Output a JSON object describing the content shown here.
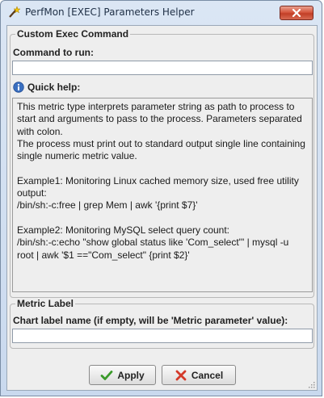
{
  "window": {
    "title": "PerfMon [EXEC] Parameters Helper",
    "close_icon": "close-icon"
  },
  "custom_exec": {
    "group_title": "Custom Exec Command",
    "command_label": "Command to run:",
    "command_value": "",
    "quick_help_label": "Quick help:",
    "help_text": "This metric type interprets parameter string as path to process to start and arguments to pass to the process. Parameters separated with colon.\nThe process must print out to standard output single line containing single numeric metric value.\n\nExample1: Monitoring Linux cached memory size, used free utility output:\n/bin/sh:-c:free | grep Mem | awk '{print $7}'\n\nExample2: Monitoring MySQL select query count:\n/bin/sh:-c:echo \"show global status like 'Com_select'\" | mysql -u root | awk '$1 ==\"Com_select\" {print $2}'"
  },
  "metric_label": {
    "group_title": "Metric Label",
    "chart_label": "Chart label name (if empty, will be 'Metric parameter' value):",
    "chart_value": ""
  },
  "buttons": {
    "apply_label": "Apply",
    "cancel_label": "Cancel"
  },
  "colors": {
    "apply_check": "#3a9a2a",
    "cancel_x": "#d43a2a",
    "info_icon": "#3a6fc0"
  }
}
